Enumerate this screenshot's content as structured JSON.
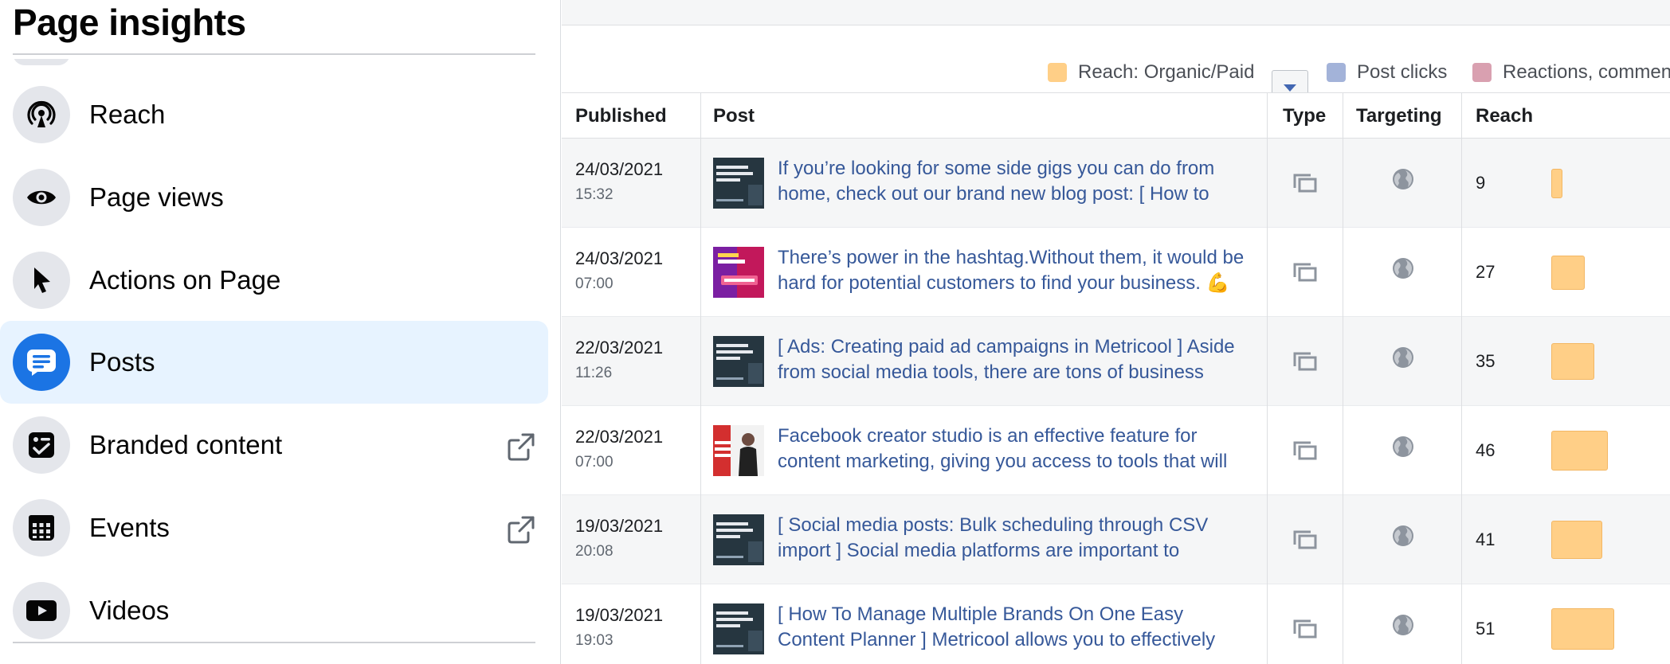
{
  "sidebar": {
    "title": "Page insights",
    "items": [
      {
        "label": "Reach",
        "icon": "reach-icon",
        "active": false,
        "external": false
      },
      {
        "label": "Page views",
        "icon": "eye-icon",
        "active": false,
        "external": false
      },
      {
        "label": "Actions on Page",
        "icon": "cursor-icon",
        "active": false,
        "external": false
      },
      {
        "label": "Posts",
        "icon": "posts-icon",
        "active": true,
        "external": false
      },
      {
        "label": "Branded content",
        "icon": "branded-content-icon",
        "active": false,
        "external": true
      },
      {
        "label": "Events",
        "icon": "calendar-icon",
        "active": false,
        "external": true
      },
      {
        "label": "Videos",
        "icon": "video-icon",
        "active": false,
        "external": false
      }
    ]
  },
  "legend": {
    "reach": "Reach: Organic/Paid",
    "post_clicks": "Post clicks",
    "reactions": "Reactions, comments",
    "colors": {
      "reach": "#ffcf87",
      "post_clicks": "#a3b3d9",
      "reactions": "#d9a0b0"
    }
  },
  "table": {
    "headers": {
      "published": "Published",
      "post": "Post",
      "type": "Type",
      "targeting": "Targeting",
      "reach": "Reach"
    },
    "rows": [
      {
        "date": "24/03/2021",
        "time": "15:32",
        "text": "If you’re looking for some side gigs you can do from home, check out our brand new blog post: [ How to",
        "reach": "9",
        "reach_value": 9,
        "thumb": "dark"
      },
      {
        "date": "24/03/2021",
        "time": "07:00",
        "text": "There’s power in the hashtag.Without them, it would be hard for potential customers to find your business. 💪💪",
        "reach": "27",
        "reach_value": 27,
        "thumb": "purple"
      },
      {
        "date": "22/03/2021",
        "time": "11:26",
        "text": "[ Ads: Creating paid ad campaigns in Metricool ] Aside from social media tools, there are tons of business",
        "reach": "35",
        "reach_value": 35,
        "thumb": "dark"
      },
      {
        "date": "22/03/2021",
        "time": "07:00",
        "text": "Facebook creator studio is an effective feature for content marketing, giving you access to tools that will",
        "reach": "46",
        "reach_value": 46,
        "thumb": "person"
      },
      {
        "date": "19/03/2021",
        "time": "20:08",
        "text": "[ Social media posts: Bulk scheduling through CSV import ] Social media platforms are important to",
        "reach": "41",
        "reach_value": 41,
        "thumb": "dark"
      },
      {
        "date": "19/03/2021",
        "time": "19:03",
        "text": "[ How To Manage Multiple Brands On One Easy Content Planner ] Metricool allows you to effectively",
        "reach": "51",
        "reach_value": 51,
        "thumb": "dark"
      }
    ]
  }
}
